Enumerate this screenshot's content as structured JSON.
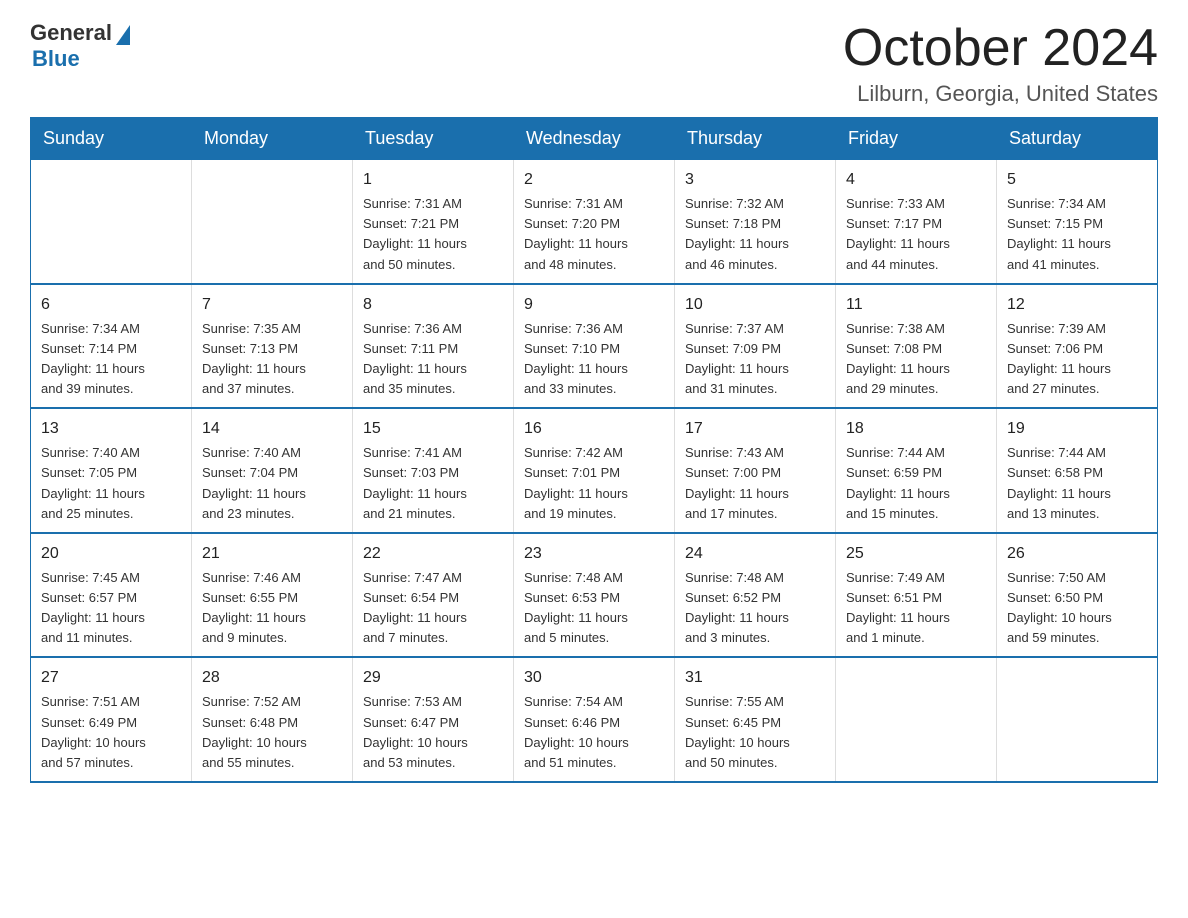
{
  "logo": {
    "general": "General",
    "blue": "Blue"
  },
  "title": {
    "month_year": "October 2024",
    "location": "Lilburn, Georgia, United States"
  },
  "weekdays": [
    "Sunday",
    "Monday",
    "Tuesday",
    "Wednesday",
    "Thursday",
    "Friday",
    "Saturday"
  ],
  "weeks": [
    [
      {
        "day": "",
        "info": ""
      },
      {
        "day": "",
        "info": ""
      },
      {
        "day": "1",
        "info": "Sunrise: 7:31 AM\nSunset: 7:21 PM\nDaylight: 11 hours\nand 50 minutes."
      },
      {
        "day": "2",
        "info": "Sunrise: 7:31 AM\nSunset: 7:20 PM\nDaylight: 11 hours\nand 48 minutes."
      },
      {
        "day": "3",
        "info": "Sunrise: 7:32 AM\nSunset: 7:18 PM\nDaylight: 11 hours\nand 46 minutes."
      },
      {
        "day": "4",
        "info": "Sunrise: 7:33 AM\nSunset: 7:17 PM\nDaylight: 11 hours\nand 44 minutes."
      },
      {
        "day": "5",
        "info": "Sunrise: 7:34 AM\nSunset: 7:15 PM\nDaylight: 11 hours\nand 41 minutes."
      }
    ],
    [
      {
        "day": "6",
        "info": "Sunrise: 7:34 AM\nSunset: 7:14 PM\nDaylight: 11 hours\nand 39 minutes."
      },
      {
        "day": "7",
        "info": "Sunrise: 7:35 AM\nSunset: 7:13 PM\nDaylight: 11 hours\nand 37 minutes."
      },
      {
        "day": "8",
        "info": "Sunrise: 7:36 AM\nSunset: 7:11 PM\nDaylight: 11 hours\nand 35 minutes."
      },
      {
        "day": "9",
        "info": "Sunrise: 7:36 AM\nSunset: 7:10 PM\nDaylight: 11 hours\nand 33 minutes."
      },
      {
        "day": "10",
        "info": "Sunrise: 7:37 AM\nSunset: 7:09 PM\nDaylight: 11 hours\nand 31 minutes."
      },
      {
        "day": "11",
        "info": "Sunrise: 7:38 AM\nSunset: 7:08 PM\nDaylight: 11 hours\nand 29 minutes."
      },
      {
        "day": "12",
        "info": "Sunrise: 7:39 AM\nSunset: 7:06 PM\nDaylight: 11 hours\nand 27 minutes."
      }
    ],
    [
      {
        "day": "13",
        "info": "Sunrise: 7:40 AM\nSunset: 7:05 PM\nDaylight: 11 hours\nand 25 minutes."
      },
      {
        "day": "14",
        "info": "Sunrise: 7:40 AM\nSunset: 7:04 PM\nDaylight: 11 hours\nand 23 minutes."
      },
      {
        "day": "15",
        "info": "Sunrise: 7:41 AM\nSunset: 7:03 PM\nDaylight: 11 hours\nand 21 minutes."
      },
      {
        "day": "16",
        "info": "Sunrise: 7:42 AM\nSunset: 7:01 PM\nDaylight: 11 hours\nand 19 minutes."
      },
      {
        "day": "17",
        "info": "Sunrise: 7:43 AM\nSunset: 7:00 PM\nDaylight: 11 hours\nand 17 minutes."
      },
      {
        "day": "18",
        "info": "Sunrise: 7:44 AM\nSunset: 6:59 PM\nDaylight: 11 hours\nand 15 minutes."
      },
      {
        "day": "19",
        "info": "Sunrise: 7:44 AM\nSunset: 6:58 PM\nDaylight: 11 hours\nand 13 minutes."
      }
    ],
    [
      {
        "day": "20",
        "info": "Sunrise: 7:45 AM\nSunset: 6:57 PM\nDaylight: 11 hours\nand 11 minutes."
      },
      {
        "day": "21",
        "info": "Sunrise: 7:46 AM\nSunset: 6:55 PM\nDaylight: 11 hours\nand 9 minutes."
      },
      {
        "day": "22",
        "info": "Sunrise: 7:47 AM\nSunset: 6:54 PM\nDaylight: 11 hours\nand 7 minutes."
      },
      {
        "day": "23",
        "info": "Sunrise: 7:48 AM\nSunset: 6:53 PM\nDaylight: 11 hours\nand 5 minutes."
      },
      {
        "day": "24",
        "info": "Sunrise: 7:48 AM\nSunset: 6:52 PM\nDaylight: 11 hours\nand 3 minutes."
      },
      {
        "day": "25",
        "info": "Sunrise: 7:49 AM\nSunset: 6:51 PM\nDaylight: 11 hours\nand 1 minute."
      },
      {
        "day": "26",
        "info": "Sunrise: 7:50 AM\nSunset: 6:50 PM\nDaylight: 10 hours\nand 59 minutes."
      }
    ],
    [
      {
        "day": "27",
        "info": "Sunrise: 7:51 AM\nSunset: 6:49 PM\nDaylight: 10 hours\nand 57 minutes."
      },
      {
        "day": "28",
        "info": "Sunrise: 7:52 AM\nSunset: 6:48 PM\nDaylight: 10 hours\nand 55 minutes."
      },
      {
        "day": "29",
        "info": "Sunrise: 7:53 AM\nSunset: 6:47 PM\nDaylight: 10 hours\nand 53 minutes."
      },
      {
        "day": "30",
        "info": "Sunrise: 7:54 AM\nSunset: 6:46 PM\nDaylight: 10 hours\nand 51 minutes."
      },
      {
        "day": "31",
        "info": "Sunrise: 7:55 AM\nSunset: 6:45 PM\nDaylight: 10 hours\nand 50 minutes."
      },
      {
        "day": "",
        "info": ""
      },
      {
        "day": "",
        "info": ""
      }
    ]
  ]
}
